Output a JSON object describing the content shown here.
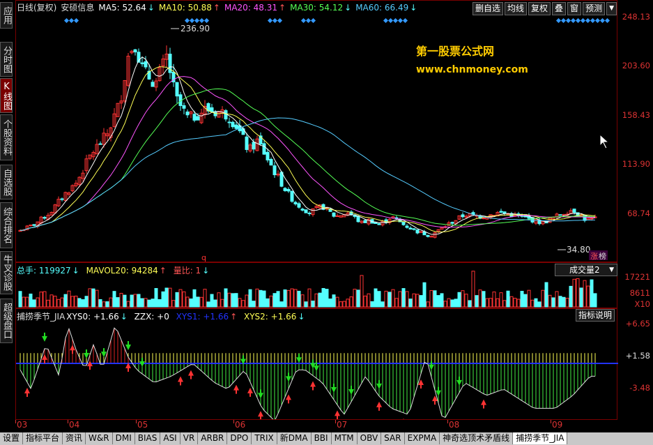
{
  "sidebar": [
    {
      "label": "应用",
      "name": "sidebar-item-apps",
      "active": false
    },
    {
      "label": "分时图",
      "name": "sidebar-item-intraday",
      "active": false
    },
    {
      "label": "K线图",
      "name": "sidebar-item-kline",
      "active": true
    },
    {
      "label": "个股资料",
      "name": "sidebar-item-stock-info",
      "active": false
    },
    {
      "label": "自选股",
      "name": "sidebar-item-watchlist",
      "active": false
    },
    {
      "label": "综合排名",
      "name": "sidebar-item-ranking",
      "active": false
    },
    {
      "label": "牛叉诊股",
      "name": "sidebar-item-diagnosis",
      "active": false
    },
    {
      "label": "超级盘口",
      "name": "sidebar-item-super-board",
      "active": false
    }
  ],
  "main": {
    "title": "日线(复权)",
    "stock": "安硕信息",
    "ma": [
      {
        "label": "MA5: 52.64",
        "arrow": "↓",
        "color": "#ffffff",
        "arrow_color": "#5ff"
      },
      {
        "label": "MA10: 50.88",
        "arrow": "↑",
        "color": "#ffff55",
        "arrow_color": "#f55"
      },
      {
        "label": "MA20: 48.31",
        "arrow": "↑",
        "color": "#ff55ff",
        "arrow_color": "#f55"
      },
      {
        "label": "MA30: 54.12",
        "arrow": "↓",
        "color": "#55ff55",
        "arrow_color": "#5ff"
      },
      {
        "label": "MA60: 66.49",
        "arrow": "↓",
        "color": "#55ccff",
        "arrow_color": "#5ff"
      }
    ],
    "toolbar": [
      "删自选",
      "均线",
      "复权",
      "叠",
      "窗",
      "预测"
    ],
    "y_ticks": [
      "248.13",
      "203.60",
      "158.43",
      "113.90",
      "68.74"
    ],
    "high_label": "236.90",
    "low_label": "34.80",
    "watermark": {
      "line1": "第一股票公式网",
      "line2": "www.chnmoney.com"
    },
    "badge_left": "涨",
    "badge_right": "榜",
    "marker": "q"
  },
  "volume": {
    "total": "总手: 119927",
    "total_arrow": "↓",
    "mavol": "MAVOL20: 94284",
    "mavol_arrow": "↑",
    "ratio": "量比: 1",
    "ratio_arrow": "↓",
    "dropdown": "成交量2",
    "y_ticks": [
      "17221",
      "8611",
      "X10"
    ]
  },
  "indicator": {
    "name": "捕捞季节_JIA",
    "xys0": "XYS0: +1.66",
    "zzx": "ZZX: +0",
    "xys1": "XYS1: +1.66",
    "xys2": "XYS2: +1.66",
    "button": "指标说明",
    "y_ticks": [
      "+6.65",
      "+1.58",
      "-3.48"
    ]
  },
  "months": [
    "03",
    "04",
    "05",
    "06",
    "07",
    "08",
    "09"
  ],
  "bottom_tabs": [
    "设置",
    "指标平台",
    "资讯",
    "W&R",
    "DMI",
    "BIAS",
    "ASI",
    "VR",
    "ARBR",
    "DPO",
    "TRIX",
    "新DMA",
    "BBI",
    "MTM",
    "OBV",
    "SAR",
    "EXPMA",
    "神奇选顶术矛盾线",
    "捕捞季节_JIA"
  ],
  "bottom_active": "捕捞季节_JIA",
  "colors": {
    "up": "#ff3333",
    "down": "#55ffff",
    "border": "#7a0000",
    "axis_text": "#dd3333"
  }
}
